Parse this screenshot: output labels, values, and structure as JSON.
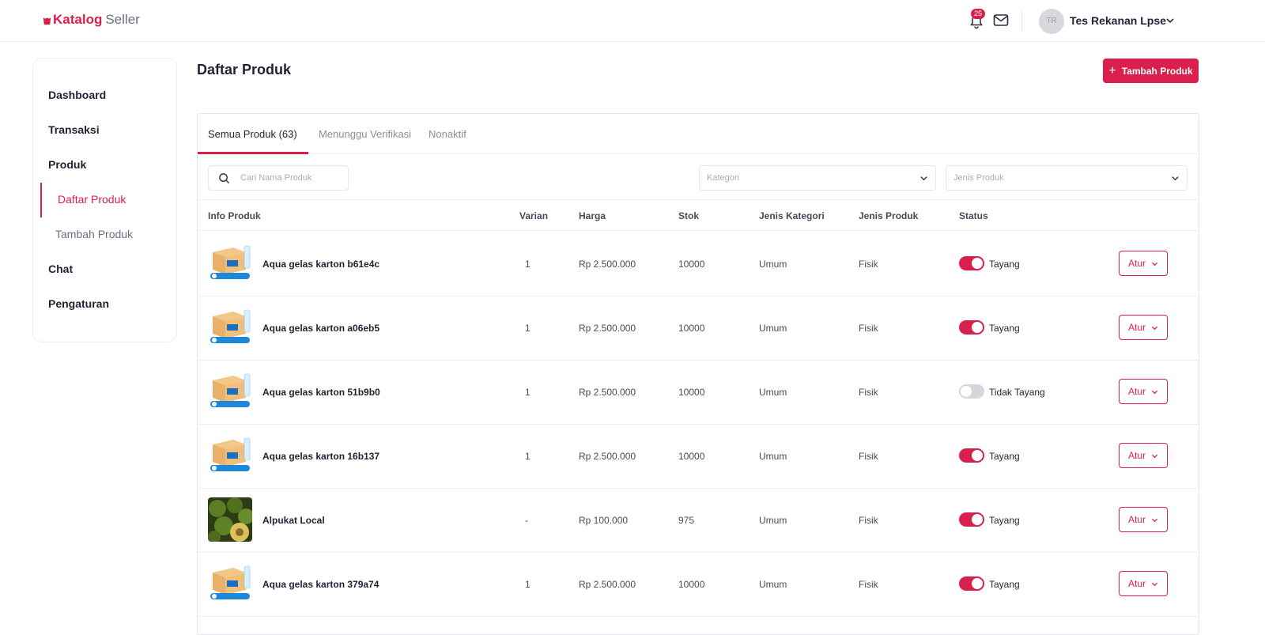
{
  "header": {
    "brand": "Katalog",
    "sub_brand": "Seller",
    "notif_count": "25",
    "user_initials": "TR",
    "user_name": "Tes Rekanan Lpse"
  },
  "sidebar": {
    "items": [
      {
        "label": "Dashboard"
      },
      {
        "label": "Transaksi"
      },
      {
        "label": "Produk"
      },
      {
        "label": "Daftar Produk"
      },
      {
        "label": "Tambah Produk"
      },
      {
        "label": "Chat"
      },
      {
        "label": "Pengaturan"
      }
    ]
  },
  "page": {
    "title": "Daftar Produk",
    "add_button": "Tambah Produk"
  },
  "tabs": [
    {
      "label": "Semua Produk (63)"
    },
    {
      "label": "Menunggu Verifikasi"
    },
    {
      "label": "Nonaktif"
    }
  ],
  "filters": {
    "search_placeholder": "Cari Nama Produk",
    "kategori_placeholder": "Kategori",
    "jenis_placeholder": "Jenis Produk"
  },
  "table": {
    "columns": [
      "Info Produk",
      "Varian",
      "Harga",
      "Stok",
      "Jenis Kategori",
      "Jenis Produk",
      "Status"
    ],
    "action_label": "Atur",
    "rows": [
      {
        "name": "Aqua gelas karton b61e4c",
        "varian": "1",
        "harga": "Rp 2.500.000",
        "stok": "10000",
        "kategori": "Umum",
        "jenis": "Fisik",
        "status": "Tayang",
        "active": true,
        "image": "aqua-box"
      },
      {
        "name": "Aqua gelas karton a06eb5",
        "varian": "1",
        "harga": "Rp 2.500.000",
        "stok": "10000",
        "kategori": "Umum",
        "jenis": "Fisik",
        "status": "Tayang",
        "active": true,
        "image": "aqua-box"
      },
      {
        "name": "Aqua gelas karton 51b9b0",
        "varian": "1",
        "harga": "Rp 2.500.000",
        "stok": "10000",
        "kategori": "Umum",
        "jenis": "Fisik",
        "status": "Tidak Tayang",
        "active": false,
        "image": "aqua-box"
      },
      {
        "name": "Aqua gelas karton 16b137",
        "varian": "1",
        "harga": "Rp 2.500.000",
        "stok": "10000",
        "kategori": "Umum",
        "jenis": "Fisik",
        "status": "Tayang",
        "active": true,
        "image": "aqua-box"
      },
      {
        "name": "Alpukat Local",
        "varian": "-",
        "harga": "Rp 100.000",
        "stok": "975",
        "kategori": "Umum",
        "jenis": "Fisik",
        "status": "Tayang",
        "active": true,
        "image": "avocado"
      },
      {
        "name": "Aqua gelas karton 379a74",
        "varian": "1",
        "harga": "Rp 2.500.000",
        "stok": "10000",
        "kategori": "Umum",
        "jenis": "Fisik",
        "status": "Tayang",
        "active": true,
        "image": "aqua-box"
      }
    ]
  },
  "colors": {
    "accent": "#d91f4b",
    "text": "#1f2233",
    "muted": "#8a8e9c",
    "toggle_off": "#d4d6dc"
  }
}
